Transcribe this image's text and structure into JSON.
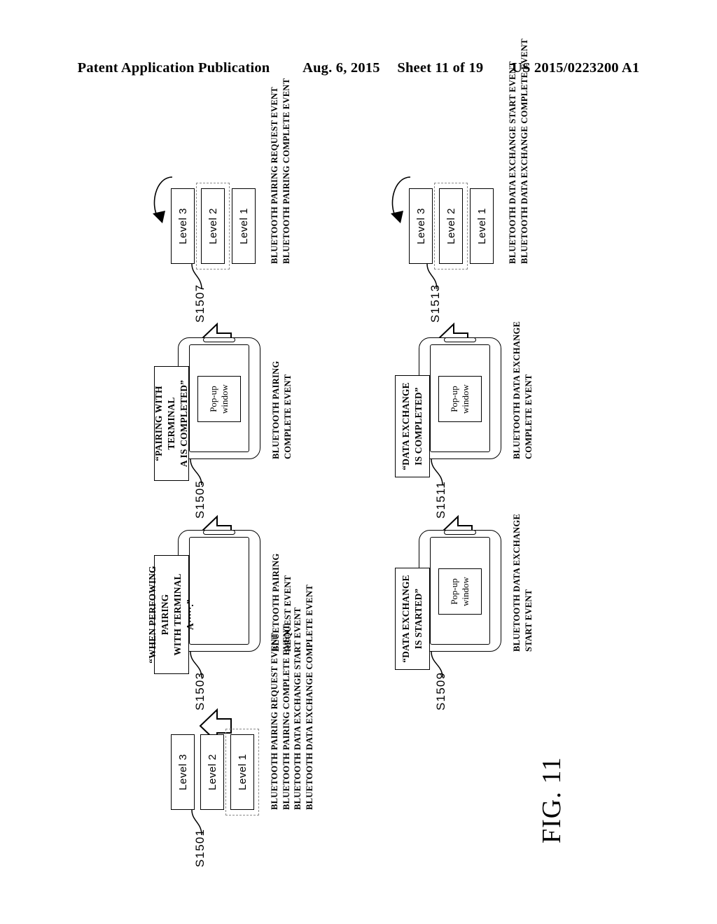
{
  "header": {
    "publication": "Patent Application Publication",
    "date": "Aug. 6, 2015",
    "sheet": "Sheet 11 of 19",
    "number": "US 2015/0223200 A1"
  },
  "figure": {
    "caption": "FIG. 11"
  },
  "levels": {
    "level1": "Level 1",
    "level2": "Level 2",
    "level3": "Level 3"
  },
  "popup": {
    "line1": "Pop-up",
    "line2": "window"
  },
  "steps": {
    "s1501": {
      "tag": "S1501",
      "highlight": "level1",
      "events": [
        "BLUETOOTH PAIRING REQUEST EVENT",
        "BLUETOOTH PAIRING COMPLETE EVENT",
        "BLUETOOTH DATA EXCHANGE START EVENT",
        "BLUETOOTH DATA EXCHANGE COMPLETE EVENT"
      ]
    },
    "s1503": {
      "tag": "S1503",
      "callout_line1": "“WHEN PERFOWING PAIRING",
      "callout_line2": "WITH TERMINAL A·····.”",
      "event_line1": "BLUETOOTH PAIRING",
      "event_line2": "REQUEST EVENT"
    },
    "s1505": {
      "tag": "S1505",
      "callout_line1": "“PAIRING WITH TERMINAL",
      "callout_line2": "A IS COMPLETED”",
      "event_line1": "BLUETOOTH PAIRING",
      "event_line2": "COMPLETE EVENT"
    },
    "s1507": {
      "tag": "S1507",
      "highlight": "level2",
      "events": [
        "BLUETOOTH PAIRING REQUEST EVENT",
        "BLUETOOTH PAIRING COMPLETE EVENT"
      ]
    },
    "s1509": {
      "tag": "S1509",
      "callout_line1": "“DATA EXCHANGE",
      "callout_line2": "IS STARTED”",
      "event_line1": "BLUETOOTH DATA EXCHANGE",
      "event_line2": "START EVENT"
    },
    "s1511": {
      "tag": "S1511",
      "callout_line1": "“DATA EXCHANGE",
      "callout_line2": "IS COMPLETED”",
      "event_line1": "BLUETOOTH DATA EXCHANGE",
      "event_line2": "COMPLETE EVENT"
    },
    "s1513": {
      "tag": "S1513",
      "highlight": "level2",
      "events": [
        "BLUETOOTH DATA EXCHANGE START EVENT",
        "BLUETOOTH DATA EXCHANGE COMPLETE EVENT"
      ]
    }
  }
}
